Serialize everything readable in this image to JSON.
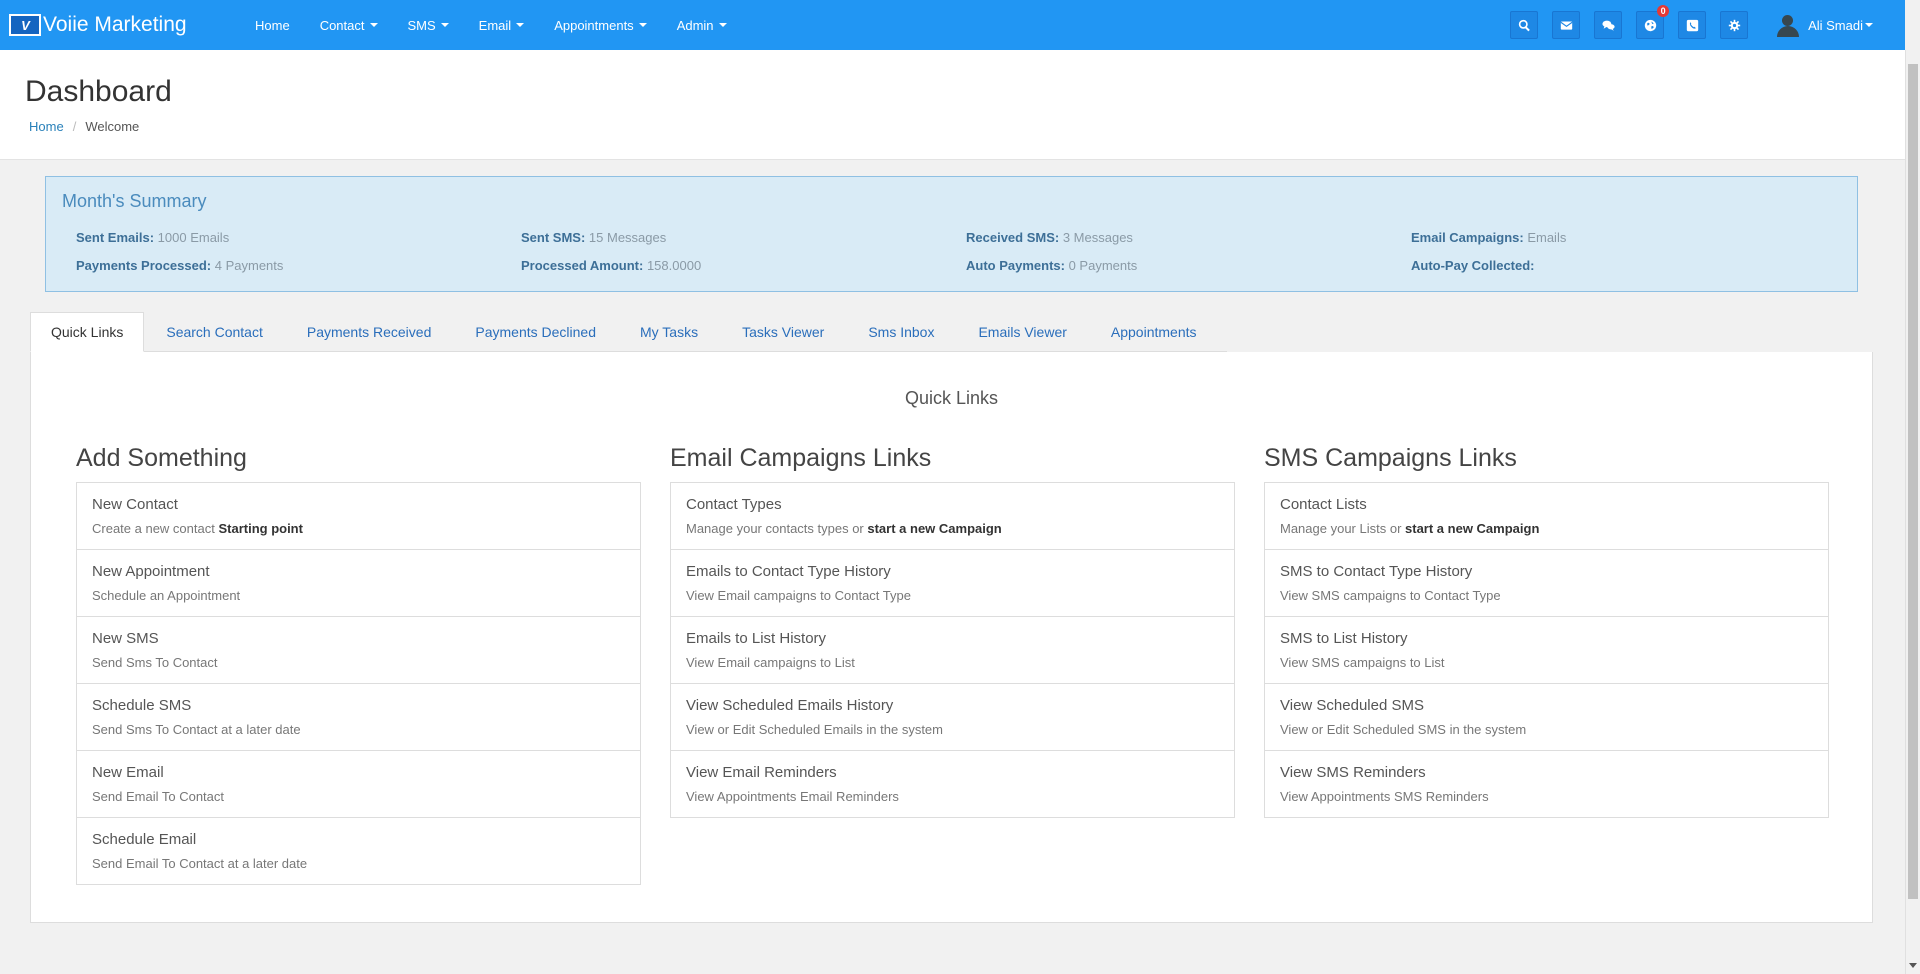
{
  "brand": {
    "logo_text": "V",
    "name": "Voiie Marketing"
  },
  "nav": {
    "items": [
      {
        "label": "Home",
        "caret": false
      },
      {
        "label": "Contact",
        "caret": true
      },
      {
        "label": "SMS",
        "caret": true
      },
      {
        "label": "Email",
        "caret": true
      },
      {
        "label": "Appointments",
        "caret": true
      },
      {
        "label": "Admin",
        "caret": true
      }
    ],
    "icons": [
      "search-icon",
      "envelope-icon",
      "comments-icon",
      "globe-icon",
      "phone-icon",
      "gear-icon"
    ],
    "globe_badge": "0",
    "user_name": "Ali Smadi"
  },
  "header": {
    "title": "Dashboard",
    "breadcrumb_home": "Home",
    "breadcrumb_current": "Welcome"
  },
  "summary": {
    "title": "Month's Summary",
    "items": [
      {
        "label": "Sent Emails:",
        "value": "1000 Emails"
      },
      {
        "label": "Sent SMS:",
        "value": "15 Messages"
      },
      {
        "label": "Received SMS:",
        "value": "3 Messages"
      },
      {
        "label": "Email Campaigns:",
        "value": "Emails"
      },
      {
        "label": "Payments Processed:",
        "value": "4 Payments"
      },
      {
        "label": "Processed Amount:",
        "value": "158.0000"
      },
      {
        "label": "Auto Payments:",
        "value": "0 Payments"
      },
      {
        "label": "Auto-Pay Collected:",
        "value": ""
      }
    ]
  },
  "tabs": [
    "Quick Links",
    "Search Contact",
    "Payments Received",
    "Payments Declined",
    "My Tasks",
    "Tasks Viewer",
    "Sms Inbox",
    "Emails Viewer",
    "Appointments"
  ],
  "quick_links": {
    "title": "Quick Links",
    "columns": [
      {
        "title": "Add Something",
        "items": [
          {
            "title": "New Contact",
            "desc": "Create a new contact ",
            "desc_bold": "Starting point"
          },
          {
            "title": "New Appointment",
            "desc": "Schedule an Appointment",
            "desc_bold": ""
          },
          {
            "title": "New SMS",
            "desc": "Send Sms To Contact",
            "desc_bold": ""
          },
          {
            "title": "Schedule SMS",
            "desc": "Send Sms To Contact at a later date",
            "desc_bold": ""
          },
          {
            "title": "New Email",
            "desc": "Send Email To Contact",
            "desc_bold": ""
          },
          {
            "title": "Schedule Email",
            "desc": "Send Email To Contact at a later date",
            "desc_bold": ""
          }
        ]
      },
      {
        "title": "Email Campaigns Links",
        "items": [
          {
            "title": "Contact Types",
            "desc": "Manage your contacts types or ",
            "desc_bold": "start a new Campaign"
          },
          {
            "title": "Emails to Contact Type History",
            "desc": "View Email campaigns to Contact Type",
            "desc_bold": ""
          },
          {
            "title": "Emails to List History",
            "desc": "View Email campaigns to List",
            "desc_bold": ""
          },
          {
            "title": "View Scheduled Emails History",
            "desc": "View or Edit Scheduled Emails in the system",
            "desc_bold": ""
          },
          {
            "title": "View Email Reminders",
            "desc": "View Appointments Email Reminders",
            "desc_bold": ""
          }
        ]
      },
      {
        "title": "SMS Campaigns Links",
        "items": [
          {
            "title": "Contact Lists",
            "desc": "Manage your Lists or ",
            "desc_bold": "start a new Campaign"
          },
          {
            "title": "SMS to Contact Type History",
            "desc": "View SMS campaigns to Contact Type",
            "desc_bold": ""
          },
          {
            "title": "SMS to List History",
            "desc": "View SMS campaigns to List",
            "desc_bold": ""
          },
          {
            "title": "View Scheduled SMS",
            "desc": "View or Edit Scheduled SMS in the system",
            "desc_bold": ""
          },
          {
            "title": "View SMS Reminders",
            "desc": "View Appointments SMS Reminders",
            "desc_bold": ""
          }
        ]
      }
    ]
  }
}
